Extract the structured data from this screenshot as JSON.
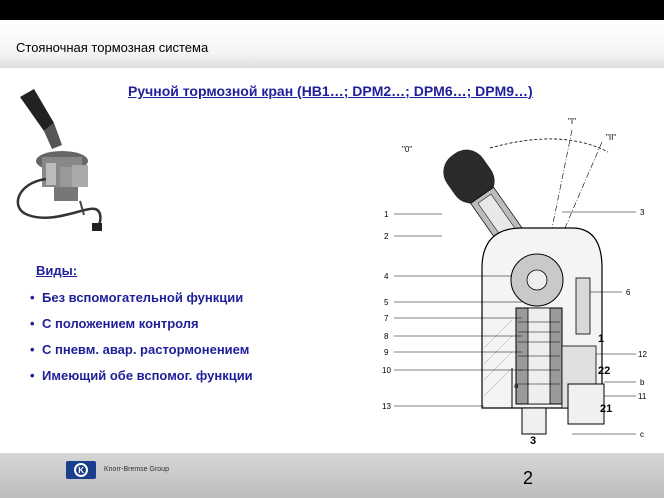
{
  "header": {
    "title": "Стояночная тормозная система"
  },
  "slide": {
    "subtitle": "Ручной тормозной кран (HB1…; DPM2…; DPM6…; DPM9…)",
    "views_heading": "Виды:",
    "bullets": [
      "Без вспомогательной функции",
      "С положением контроля",
      "С пневм. авар. растормонением",
      "Имеющий обе вспомог. функции"
    ]
  },
  "diagram": {
    "positions": [
      "\"0\"",
      "\"I\"",
      "\"II\""
    ],
    "left_callouts": [
      "1",
      "2",
      "4",
      "5",
      "7",
      "8",
      "9",
      "10",
      "13"
    ],
    "right_callouts": [
      "3",
      "6",
      "12",
      "b",
      "11",
      "c"
    ],
    "port_labels": [
      "1",
      "22",
      "21",
      "3"
    ],
    "internal_labels": [
      "a"
    ]
  },
  "footer": {
    "company": "Knorr-Bremse Group",
    "page_number": "2"
  },
  "colors": {
    "accent_text": "#1f1f9a",
    "top_bar": "#000000",
    "footer_bar": "#c8c8c8",
    "logo_blue": "#1b3f8c"
  }
}
